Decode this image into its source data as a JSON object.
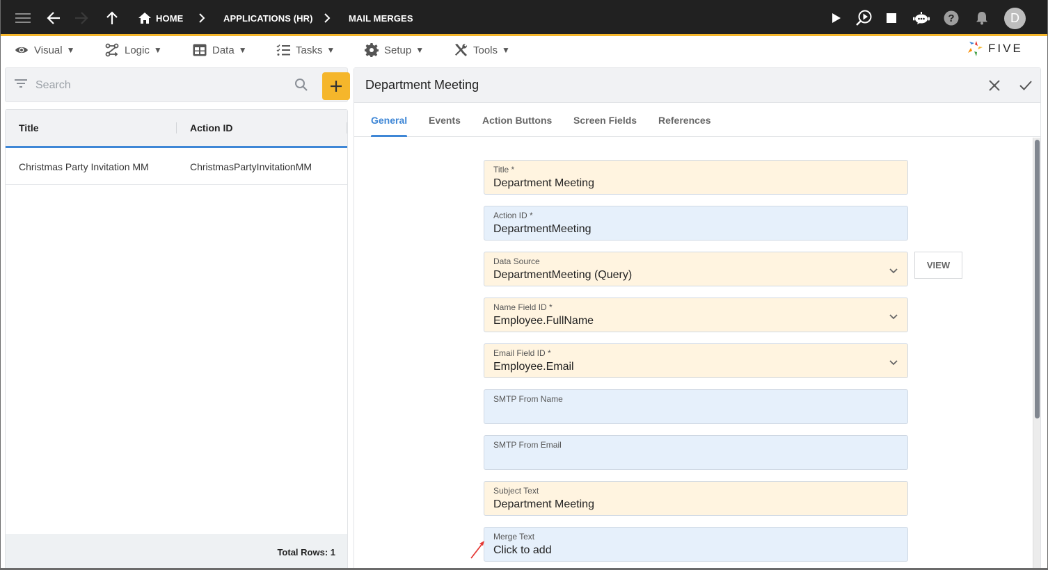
{
  "topbar": {
    "breadcrumbs": [
      {
        "label": "HOME",
        "icon": "home-icon"
      },
      {
        "label": "APPLICATIONS (HR)"
      },
      {
        "label": "MAIL MERGES"
      }
    ],
    "nav_icons": [
      "menu-icon",
      "back-arrow-icon",
      "forward-arrow-icon",
      "up-arrow-icon"
    ],
    "action_icons": [
      "play-icon",
      "debug-run-icon",
      "stop-icon",
      "chat-bot-icon",
      "help-icon",
      "notifications-bell-icon"
    ],
    "avatar_initial": "D",
    "accent_color": "#f5b62b"
  },
  "menubar": {
    "items": [
      {
        "label": "Visual",
        "icon": "eye-icon"
      },
      {
        "label": "Logic",
        "icon": "logic-flow-icon"
      },
      {
        "label": "Data",
        "icon": "table-icon"
      },
      {
        "label": "Tasks",
        "icon": "checklist-icon"
      },
      {
        "label": "Setup",
        "icon": "gear-icon"
      },
      {
        "label": "Tools",
        "icon": "tools-icon"
      }
    ],
    "caret": "▼",
    "logo_text": "FIVE"
  },
  "list": {
    "search_placeholder": "Search",
    "columns": [
      "Title",
      "Action ID"
    ],
    "rows": [
      {
        "title": "Christmas Party Invitation MM",
        "action_id": "ChristmasPartyInvitationMM"
      }
    ],
    "total_rows_label": "Total Rows: 1"
  },
  "detail": {
    "title": "Department Meeting",
    "tabs": [
      {
        "label": "General",
        "active": true
      },
      {
        "label": "Events"
      },
      {
        "label": "Action Buttons"
      },
      {
        "label": "Screen Fields"
      },
      {
        "label": "References"
      }
    ],
    "fields": [
      {
        "label": "Title *",
        "value": "Department Meeting",
        "style": "yellow"
      },
      {
        "label": "Action ID *",
        "value": "DepartmentMeeting",
        "style": "blue"
      },
      {
        "label": "Data Source",
        "value": "DepartmentMeeting (Query)",
        "style": "yellow",
        "dropdown": true
      },
      {
        "label": "Name Field ID *",
        "value": "Employee.FullName",
        "style": "yellow",
        "dropdown": true
      },
      {
        "label": "Email Field ID *",
        "value": "Employee.Email",
        "style": "yellow",
        "dropdown": true
      },
      {
        "label": "SMTP From Name",
        "value": "",
        "style": "blue"
      },
      {
        "label": "SMTP From Email",
        "value": "",
        "style": "blue"
      },
      {
        "label": "Subject Text",
        "value": "Department Meeting",
        "style": "yellow"
      },
      {
        "label": "Merge Text",
        "value": "Click to add",
        "style": "blue"
      }
    ],
    "view_button_label": "VIEW",
    "scroll_position_fraction": 0.0,
    "scroll_visible_fraction": 0.65
  }
}
